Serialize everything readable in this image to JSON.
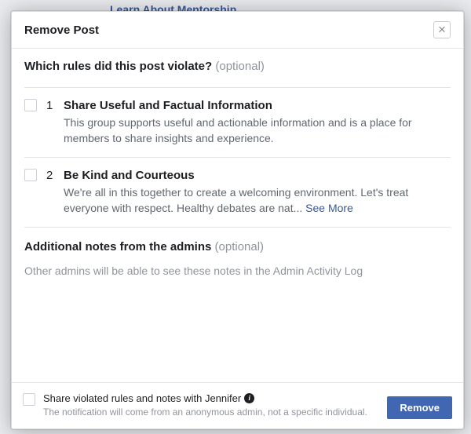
{
  "bg_link": "Learn About Mentorship",
  "header": {
    "title": "Remove Post",
    "close_glyph": "×"
  },
  "body": {
    "question": "Which rules did this post violate? ",
    "optional": "(optional)",
    "see_more": "See More",
    "rules": [
      {
        "num": "1",
        "title": "Share Useful and Factual Information",
        "desc": "This group supports useful and actionable information and is a place for members to share insights and experience."
      },
      {
        "num": "2",
        "title": "Be Kind and Courteous",
        "desc": "We're all in this together to create a welcoming environment. Let's treat everyone with respect. Healthy debates are nat... "
      }
    ]
  },
  "notes": {
    "title": "Additional notes from the admins ",
    "optional": "(optional)",
    "placeholder": "Other admins will be able to see these notes in the Admin Activity Log"
  },
  "footer": {
    "share_label": "Share violated rules and notes with Jennifer",
    "share_desc": "The notification will come from an anonymous admin, not a specific individual.",
    "remove_label": "Remove"
  }
}
